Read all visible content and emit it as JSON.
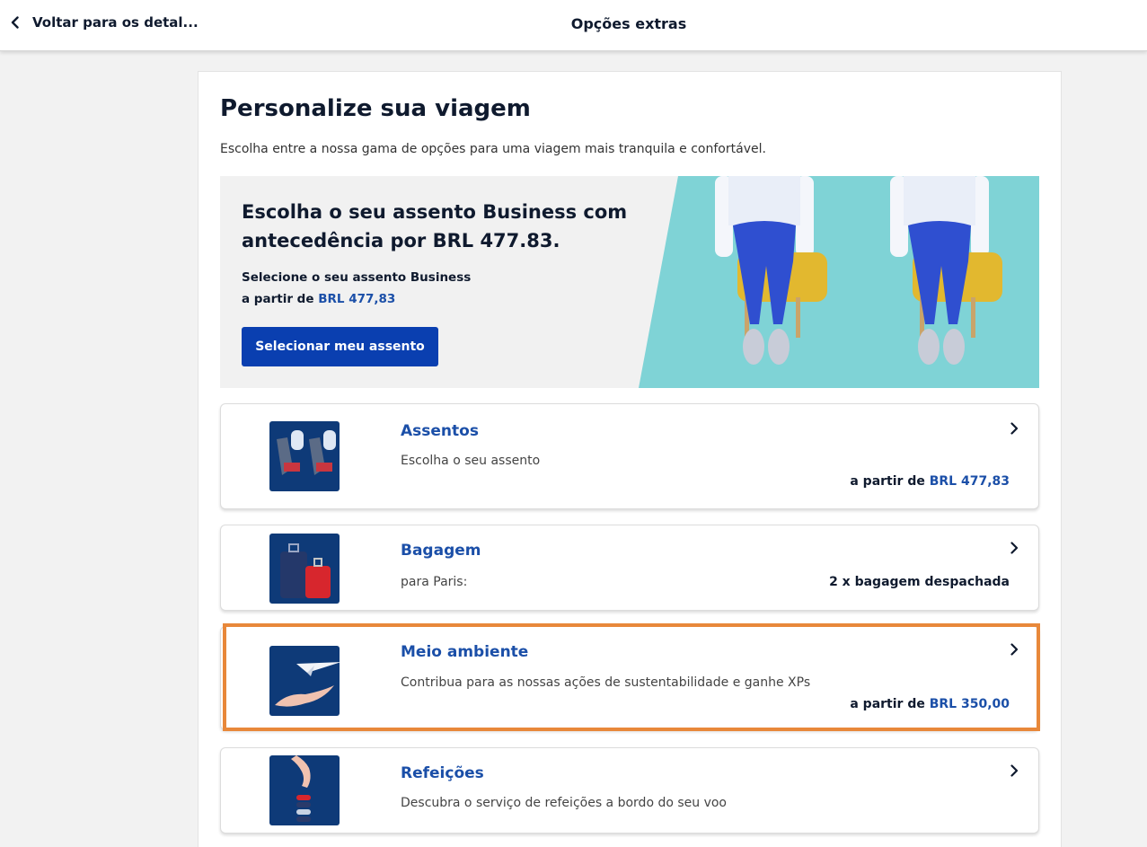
{
  "header": {
    "back_label": "Voltar para os detal...",
    "title": "Opções extras"
  },
  "page": {
    "title": "Personalize sua viagem",
    "subtitle": "Escolha entre a nossa gama de opções para uma viagem mais tranquila e confortável."
  },
  "banner": {
    "heading": "Escolha o seu assento Business com antecedência por BRL 477.83.",
    "line1": "Selecione o seu assento Business",
    "line2_prefix": "a partir de ",
    "line2_price": "BRL 477,83",
    "button_label": "Selecionar meu assento"
  },
  "cards": [
    {
      "title": "Assentos",
      "description": "Escolha o seu assento",
      "price_prefix": "a partir de ",
      "price": "BRL 477,83",
      "icon": "seat-icon"
    },
    {
      "title": "Bagagem",
      "description": "para Paris:",
      "right_text": "2 x bagagem despachada",
      "icon": "luggage-icon"
    },
    {
      "title": "Meio ambiente",
      "description": "Contribua para as nossas ações de sustentabilidade e ganhe XPs",
      "price_prefix": "a partir de ",
      "price": "BRL 350,00",
      "icon": "paper-plane-icon"
    },
    {
      "title": "Refeições",
      "description": "Descubra o serviço de refeições a bordo do seu voo",
      "icon": "meal-icon"
    }
  ],
  "colors": {
    "primary_button": "#0a3fb0",
    "link_blue": "#1b4fa8",
    "highlight_outline": "#e8883a",
    "banner_photo_bg": "#7fd3d6"
  }
}
